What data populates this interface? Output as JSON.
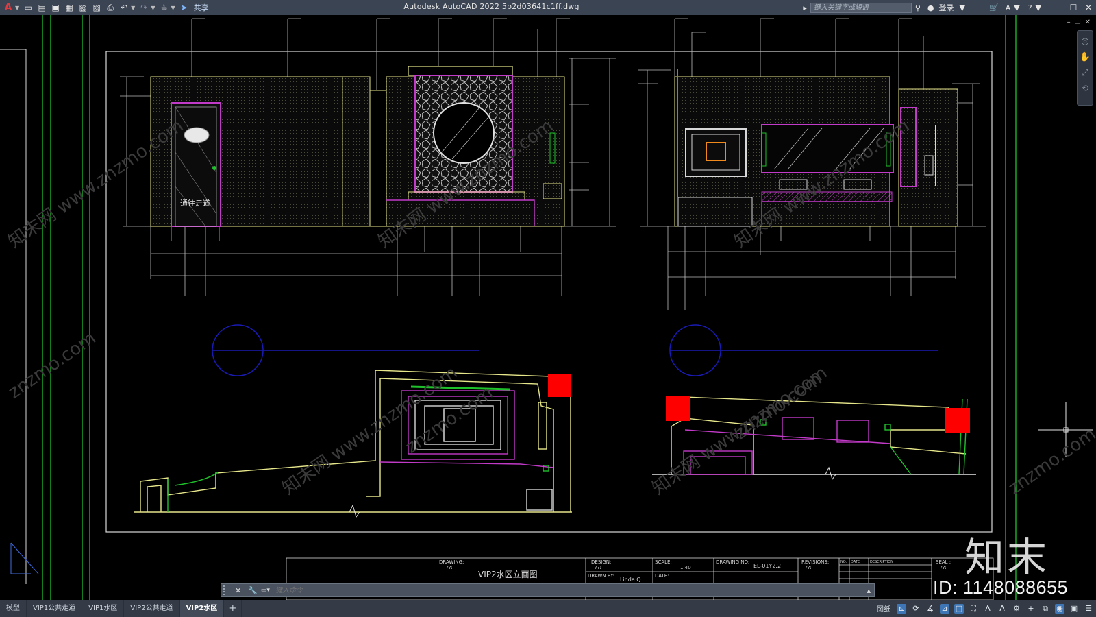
{
  "titlebar": {
    "app_logo": "A",
    "share_label": "共享",
    "title": "Autodesk AutoCAD 2022    5b2d03641c1ff.dwg",
    "search_placeholder": "键入关键字或短语",
    "login_label": "登录"
  },
  "drawing": {
    "door_label": "通往走道",
    "title_block": {
      "drawing_label": "DRAWING:",
      "drawing_value": "??:",
      "sheet_title": "VIP2水区立面图",
      "design_label": "DESIGN:",
      "design_value": "??:",
      "drawn_by_label": "DRAWN BY:",
      "drawn_by_value": "Linda.Q",
      "scale_label": "SCALE:",
      "scale_value": "1:40",
      "date_label": "DATE:",
      "drawing_no_label": "DRAWING NO:",
      "drawing_no_value": "EL-01Y2.2",
      "revisions_label": "REVISIONS:",
      "revisions_value": "??:",
      "seal_label": "SEAL :",
      "seal_value": "??:",
      "rev_col_no": "NO.",
      "rev_col_date": "DATE",
      "rev_col_desc": "DESCRIPTION"
    }
  },
  "watermark": {
    "logo": "知末",
    "id": "ID: 1148088655",
    "url": "znzmo.com",
    "site": "知末网 www.znzmo.com"
  },
  "command_line": {
    "placeholder": "键入命令"
  },
  "status_bar": {
    "tabs": [
      "模型",
      "VIP1公共走道",
      "VIP1水区",
      "VIP2公共走道",
      "VIP2水区"
    ],
    "active_tab": "VIP2水区",
    "paper_label": "图纸"
  },
  "colors": {
    "canvas": "#000000",
    "titlebar": "#3b4453",
    "yellow_line": "#e6e68a",
    "magenta_line": "#c23ac8",
    "green_line": "#1fc12b",
    "red_block": "#ff0000",
    "blue_line": "#1a1ab4",
    "white_line": "#d8d8d8"
  }
}
